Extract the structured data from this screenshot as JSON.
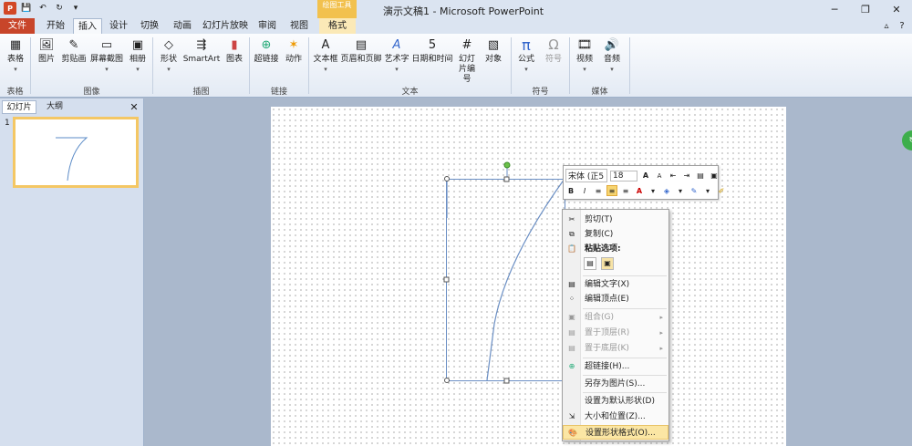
{
  "window": {
    "title": "演示文稿1 - Microsoft PowerPoint",
    "context_tab_group": "绘图工具",
    "controls": {
      "minimize": "─",
      "restore": "❐",
      "close": "✕"
    }
  },
  "tabs": [
    "文件",
    "开始",
    "插入",
    "设计",
    "切换",
    "动画",
    "幻灯片放映",
    "审阅",
    "视图",
    "格式"
  ],
  "ribbon": {
    "buttons": [
      {
        "label": "表格",
        "icon": "▦"
      },
      {
        "label": "图片",
        "icon": "🖼"
      },
      {
        "label": "剪贴画",
        "icon": "✎"
      },
      {
        "label": "屏幕截图",
        "icon": "▭"
      },
      {
        "label": "相册",
        "icon": "▣"
      },
      {
        "label": "形状",
        "icon": "◇"
      },
      {
        "label": "SmartArt",
        "icon": "⇶"
      },
      {
        "label": "图表",
        "icon": "▮"
      },
      {
        "label": "超链接",
        "icon": "⊕"
      },
      {
        "label": "动作",
        "icon": "✶"
      },
      {
        "label": "文本框",
        "icon": "A"
      },
      {
        "label": "页眉和页脚",
        "icon": "▤"
      },
      {
        "label": "艺术字",
        "icon": "A"
      },
      {
        "label": "日期和时间",
        "icon": "5"
      },
      {
        "label": "幻灯片编号",
        "icon": "#"
      },
      {
        "label": "对象",
        "icon": "▧"
      },
      {
        "label": "公式",
        "icon": "π"
      },
      {
        "label": "符号",
        "icon": "Ω"
      },
      {
        "label": "视频",
        "icon": "🎞"
      },
      {
        "label": "音频",
        "icon": "🔊"
      }
    ],
    "groups": [
      "表格",
      "图像",
      "插图",
      "链接",
      "文本",
      "符号",
      "媒体"
    ]
  },
  "pane": {
    "tab_slides": "幻灯片",
    "tab_outline": "大纲",
    "close": "✕",
    "slide_number": "1"
  },
  "minibar": {
    "font": "宋体 (正5 -",
    "size": "18",
    "grow": "A",
    "shrink": "A",
    "bold": "B",
    "italic": "I"
  },
  "context_menu": {
    "items": [
      {
        "label": "剪切(T)",
        "icon": "✂",
        "disabled": false
      },
      {
        "label": "复制(C)",
        "icon": "⧉",
        "disabled": false
      },
      {
        "label": "粘贴选项:",
        "icon": "📋",
        "disabled": false,
        "bold": true
      },
      {
        "label": "编辑文字(X)",
        "icon": "▤",
        "disabled": false
      },
      {
        "label": "编辑顶点(E)",
        "icon": "⁘",
        "disabled": false
      },
      {
        "label": "组合(G)",
        "icon": "▣",
        "disabled": true,
        "submenu": true
      },
      {
        "label": "置于顶层(R)",
        "icon": "▤",
        "disabled": true,
        "submenu": true
      },
      {
        "label": "置于底层(K)",
        "icon": "▤",
        "disabled": true,
        "submenu": true
      },
      {
        "label": "超链接(H)...",
        "icon": "⊕",
        "disabled": false
      },
      {
        "label": "另存为图片(S)...",
        "icon": "",
        "disabled": false
      },
      {
        "label": "设置为默认形状(D)",
        "icon": "",
        "disabled": false
      },
      {
        "label": "大小和位置(Z)...",
        "icon": "⇲",
        "disabled": false
      },
      {
        "label": "设置形状格式(O)...",
        "icon": "🎨",
        "disabled": false,
        "highlighted": true
      }
    ]
  }
}
